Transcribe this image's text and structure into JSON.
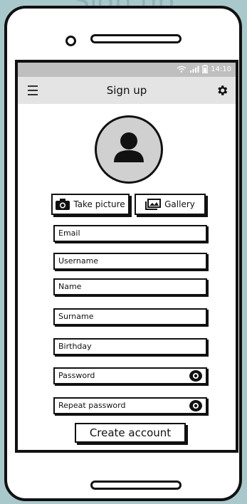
{
  "background_title": "Sign up",
  "status": {
    "time": "14:10"
  },
  "appbar": {
    "title": "Sign up"
  },
  "buttons": {
    "take_picture": "Take picture",
    "gallery": "Gallery",
    "create_account": "Create account"
  },
  "fields": [
    {
      "label": "Email",
      "icon": null
    },
    {
      "label": "Username",
      "icon": null
    },
    {
      "label": "Name",
      "icon": null
    },
    {
      "label": "Surname",
      "icon": null
    },
    {
      "label": "Birthday",
      "icon": null
    },
    {
      "label": "Password",
      "icon": "eye-icon"
    },
    {
      "label": "Repeat password",
      "icon": "eye-icon"
    }
  ],
  "colors": {
    "page_background": "#a9c8cc",
    "statusbar": "#bfbfbf",
    "appbar": "#e4e4e4",
    "avatar": "#d0d0d0"
  }
}
